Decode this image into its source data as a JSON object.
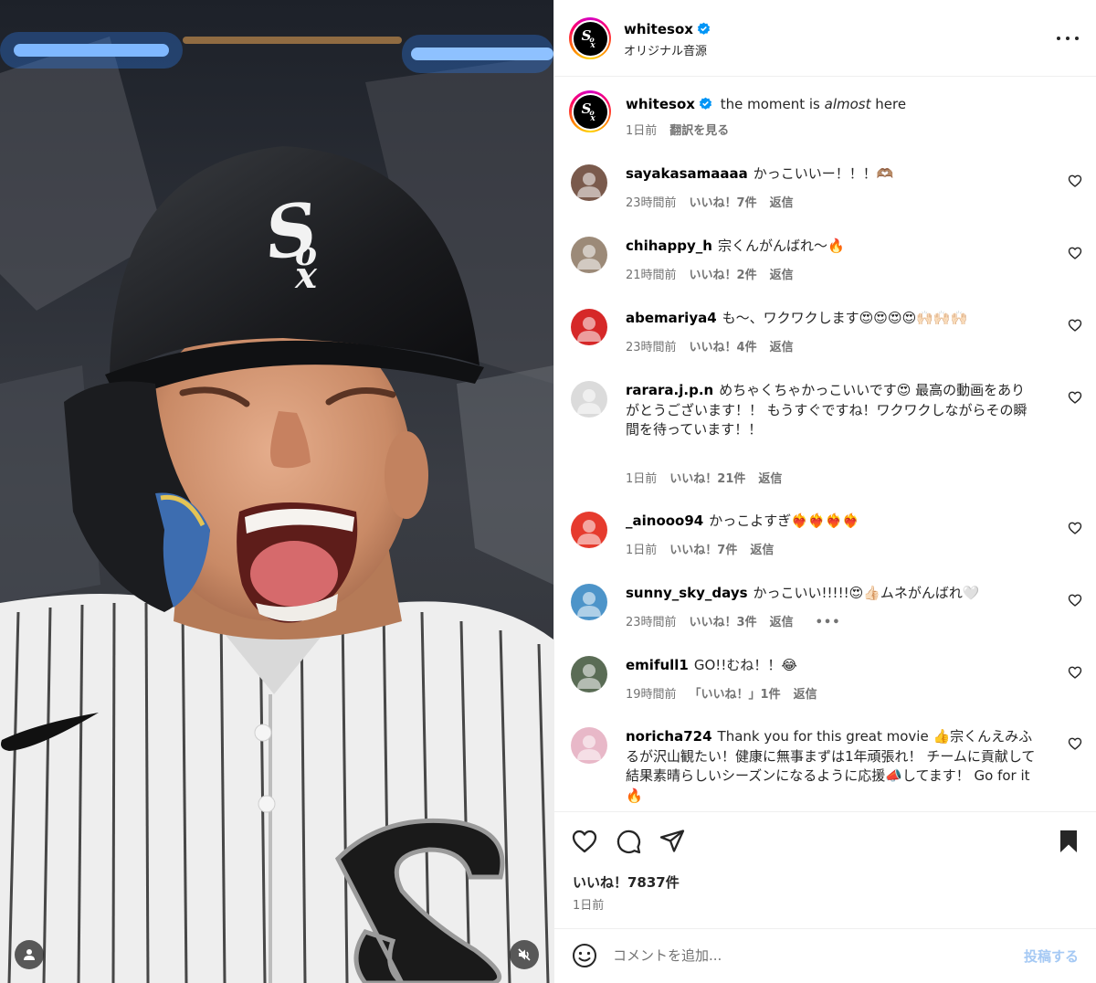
{
  "post": {
    "account": "whitesox",
    "audio_label": "オリジナル音源",
    "caption": {
      "username": "whitesox",
      "text_before": "the moment is ",
      "text_italic": "almost",
      "text_after": " here",
      "time": "1日前",
      "translate": "翻訳を見る"
    },
    "likes": "いいね！7837件",
    "date": "1日前"
  },
  "comments": [
    {
      "username": "sayakasamaaaa",
      "text": "かっこいいー！！！🫶🏽",
      "time": "23時間前",
      "likes": "いいね！7件",
      "reply": "返信",
      "more": "",
      "avatar_color": "#7a5a4c"
    },
    {
      "username": "chihappy_h",
      "text": "宗くんがんばれ〜🔥",
      "time": "21時間前",
      "likes": "いいね！2件",
      "reply": "返信",
      "more": "",
      "avatar_color": "#9c8a78"
    },
    {
      "username": "abemariya4",
      "text": "も〜、ワクワクします😍😍😍😍🙌🏻🙌🏻🙌🏻",
      "time": "23時間前",
      "likes": "いいね！4件",
      "reply": "返信",
      "more": "",
      "avatar_color": "#d62828"
    },
    {
      "username": "rarara.j.p.n",
      "text": "めちゃくちゃかっこいいです😍 最高の動画をありがとうございます！！ もうすぐですね！ワクワクしながらその瞬間を待っています！！",
      "time": "1日前",
      "likes": "いいね！21件",
      "reply": "返信",
      "more": "",
      "avatar_color": "#dbdbdb"
    },
    {
      "username": "_ainooo94",
      "text": "かっこよすぎ❤️‍🔥❤️‍🔥❤️‍🔥❤️‍🔥",
      "time": "1日前",
      "likes": "いいね！7件",
      "reply": "返信",
      "more": "",
      "avatar_color": "#e63b2e"
    },
    {
      "username": "sunny_sky_days",
      "text": "かっこいい!!!!!😍👍🏻ムネがんばれ🤍",
      "time": "23時間前",
      "likes": "いいね！3件",
      "reply": "返信",
      "more": "•••",
      "avatar_color": "#4d94c9"
    },
    {
      "username": "emifull1",
      "text": "GO!!むね！！😂",
      "time": "19時間前",
      "likes": "「いいね！」1件",
      "reply": "返信",
      "more": "",
      "avatar_color": "#5a6c55"
    },
    {
      "username": "noricha724",
      "text": "Thank you for this great movie 👍宗くんえみふるが沢山観たい！健康に無事まずは1年頑張れ！ チームに貢献して結果素晴らしいシーズンになるように応援📣してます！ Go for it 🔥",
      "time": "",
      "likes": "",
      "reply": "",
      "more": "",
      "avatar_color": "#e8b8c8"
    }
  ],
  "input": {
    "placeholder": "コメントを追加...",
    "post_label": "投稿する"
  },
  "colors": {
    "accent_blue": "#0095f6",
    "verified_blue": "#0095f6",
    "muted_text": "#737373"
  }
}
